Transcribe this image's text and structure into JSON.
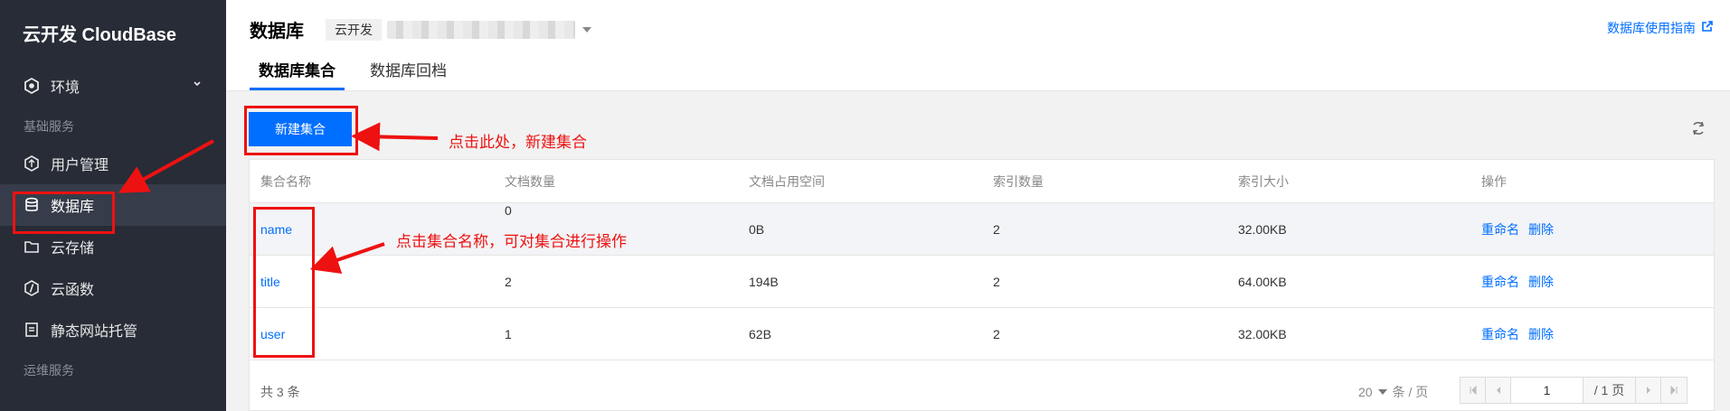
{
  "sidebar": {
    "brand": "云开发 CloudBase",
    "env": {
      "label": "环境"
    },
    "groups": [
      "基础服务",
      "运维服务"
    ],
    "items": [
      {
        "label": "用户管理",
        "icon": "user-management-icon"
      },
      {
        "label": "数据库",
        "icon": "database-icon"
      },
      {
        "label": "云存储",
        "icon": "folder-icon"
      },
      {
        "label": "云函数",
        "icon": "function-icon"
      },
      {
        "label": "静态网站托管",
        "icon": "document-icon"
      }
    ]
  },
  "header": {
    "title": "数据库",
    "env_tag": "云开发",
    "guide_link": "数据库使用指南",
    "tabs": [
      "数据库集合",
      "数据库回档"
    ]
  },
  "toolbar": {
    "new_collection": "新建集合"
  },
  "table": {
    "columns": [
      "集合名称",
      "文档数量",
      "文档占用空间",
      "索引数量",
      "索引大小",
      "操作"
    ],
    "rows": [
      {
        "name": "name",
        "docs": "0",
        "space": "0B",
        "indexes": "2",
        "index_size": "32.00KB"
      },
      {
        "name": "title",
        "docs": "2",
        "space": "194B",
        "indexes": "2",
        "index_size": "64.00KB"
      },
      {
        "name": "user",
        "docs": "1",
        "space": "62B",
        "indexes": "2",
        "index_size": "32.00KB"
      }
    ],
    "ops": {
      "rename": "重命名",
      "delete": "删除"
    },
    "footer": {
      "total": "共 3 条",
      "page_size": "20",
      "page_size_unit": "条 / 页",
      "page": "1",
      "page_total": "/ 1 页"
    }
  },
  "annotations": {
    "new_collection_hint": "点击此处，新建集合",
    "collection_name_hint": "点击集合名称，可对集合进行操作"
  },
  "colors": {
    "accent": "#006eff",
    "annotation": "#ee1111",
    "sidebar": "#272c36"
  }
}
